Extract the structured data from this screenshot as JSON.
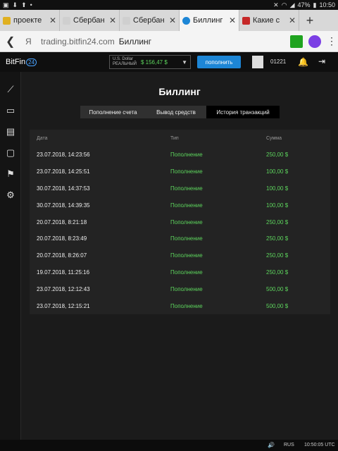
{
  "statusbar": {
    "battery": "47%",
    "time": "10:50"
  },
  "browser_tabs": [
    {
      "title": "проекте",
      "fav_color": "#e0b020",
      "active": false
    },
    {
      "title": "Сбербан",
      "fav_color": "#cfcfcf",
      "active": false
    },
    {
      "title": "Сбербан",
      "fav_color": "#cfcfcf",
      "active": false
    },
    {
      "title": "Биллинг",
      "fav_color": "#1d86d6",
      "active": true
    },
    {
      "title": "Какие с",
      "fav_color": "#c62828",
      "active": false
    }
  ],
  "urlbar": {
    "search_engine": "Я",
    "host": "trading.bitfin24.com",
    "page": "Биллинг"
  },
  "app": {
    "logo_text": "BitFin",
    "logo_badge": "24",
    "account": {
      "currency": "U.S. Dollar",
      "type": "РЕАЛЬНЫЙ",
      "balance": "$ 156,47 $"
    },
    "deposit_button": "пополнить",
    "user_id": "01221"
  },
  "sidebar": [
    {
      "icon": "chart-icon",
      "glyph": "⟋"
    },
    {
      "icon": "card-icon",
      "glyph": "▭"
    },
    {
      "icon": "document-icon",
      "glyph": "▤"
    },
    {
      "icon": "chat-icon",
      "glyph": "▢"
    },
    {
      "icon": "flag-icon",
      "glyph": "⚑"
    },
    {
      "icon": "gear-icon",
      "glyph": "⚙"
    }
  ],
  "billing": {
    "title": "Биллинг",
    "tabs": [
      "Пополнение счета",
      "Вывод средств",
      "История транзакций"
    ],
    "columns": [
      "Дата",
      "Тип",
      "Сумма"
    ],
    "rows": [
      {
        "date": "23.07.2018, 14:23:56",
        "type": "Пополнение",
        "amount": "250,00 $"
      },
      {
        "date": "23.07.2018, 14:25:51",
        "type": "Пополнение",
        "amount": "100,00 $"
      },
      {
        "date": "30.07.2018, 14:37:53",
        "type": "Пополнение",
        "amount": "100,00 $"
      },
      {
        "date": "30.07.2018, 14:39:35",
        "type": "Пополнение",
        "amount": "100,00 $"
      },
      {
        "date": "20.07.2018, 8:21:18",
        "type": "Пополнение",
        "amount": "250,00 $"
      },
      {
        "date": "20.07.2018, 8:23:49",
        "type": "Пополнение",
        "amount": "250,00 $"
      },
      {
        "date": "20.07.2018, 8:26:07",
        "type": "Пополнение",
        "amount": "250,00 $"
      },
      {
        "date": "19.07.2018, 11:25:16",
        "type": "Пополнение",
        "amount": "250,00 $"
      },
      {
        "date": "23.07.2018, 12:12:43",
        "type": "Пополнение",
        "amount": "500,00 $"
      },
      {
        "date": "23.07.2018, 12:15:21",
        "type": "Пополнение",
        "amount": "500,00 $"
      }
    ]
  },
  "footer": {
    "lang": "RUS",
    "time": "10:50:05 UTC"
  }
}
